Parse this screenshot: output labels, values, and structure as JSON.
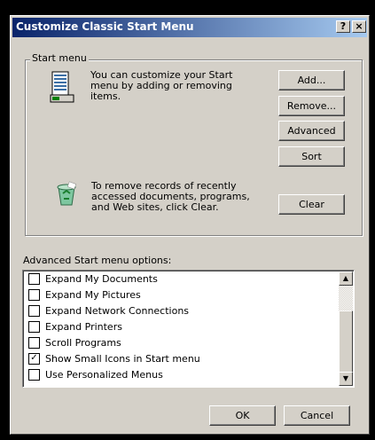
{
  "window": {
    "title": "Customize Classic Start Menu",
    "help_glyph": "?",
    "close_glyph": "×"
  },
  "start_menu_group": {
    "legend": "Start menu",
    "customize_text": "You can customize your Start menu by adding or removing items.",
    "clear_text": "To remove records of recently accessed documents, programs, and Web sites, click Clear.",
    "buttons": {
      "add": "Add...",
      "remove": "Remove...",
      "advanced": "Advanced",
      "sort": "Sort",
      "clear": "Clear"
    },
    "icons": [
      "start-menu-icon",
      "recycle-bin-icon"
    ]
  },
  "advanced_options": {
    "label": "Advanced Start menu options:",
    "items": [
      {
        "label": "Expand My Documents",
        "checked": false
      },
      {
        "label": "Expand My Pictures",
        "checked": false
      },
      {
        "label": "Expand Network Connections",
        "checked": false
      },
      {
        "label": "Expand Printers",
        "checked": false
      },
      {
        "label": "Scroll Programs",
        "checked": false
      },
      {
        "label": "Show Small Icons in Start menu",
        "checked": true
      },
      {
        "label": "Use Personalized Menus",
        "checked": false
      }
    ],
    "scroll_up_glyph": "▲",
    "scroll_down_glyph": "▼"
  },
  "footer": {
    "ok": "OK",
    "cancel": "Cancel"
  },
  "colors": {
    "dialog_face": "#d4d0c8",
    "titlebar_start": "#0a246a",
    "titlebar_end": "#a6caf0",
    "background": "#000000"
  }
}
